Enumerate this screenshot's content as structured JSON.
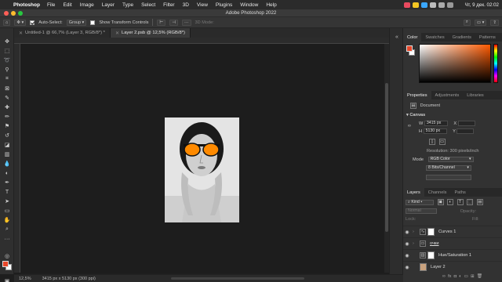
{
  "menubar": {
    "app_name": "Photoshop",
    "items": [
      "File",
      "Edit",
      "Image",
      "Layer",
      "Type",
      "Select",
      "Filter",
      "3D",
      "View",
      "Plugins",
      "Window",
      "Help"
    ],
    "clock": "Чт, 9 дек.  02:02"
  },
  "window": {
    "title": "Adobe Photoshop 2022"
  },
  "options_bar": {
    "auto_select_label": "Auto-Select:",
    "auto_select_value": "Group",
    "show_transform_label": "Show Transform Controls",
    "mode_3d_label": "3D Mode:"
  },
  "document_tabs": [
    {
      "label": "Untitled-1 @ 66,7% (Layer 3, RGB/8*) *",
      "active": false
    },
    {
      "label": "Layer 2.psb @ 12,5% (RGB/8*)",
      "active": true
    }
  ],
  "status_bar": {
    "zoom": "12,5%",
    "dimensions": "3415 px x 5130 px (300 ppi)"
  },
  "color_panel": {
    "tabs": [
      "Color",
      "Swatches",
      "Gradients",
      "Patterns"
    ],
    "foreground": "#e8472a",
    "background": "#ffffff"
  },
  "properties_panel": {
    "tabs": [
      "Properties",
      "Adjustments",
      "Libraries"
    ],
    "document_label": "Document",
    "canvas_label": "Canvas",
    "width_label": "W",
    "width_value": "3415 px",
    "height_label": "H",
    "height_value": "5130 px",
    "x_label": "X",
    "y_label": "Y",
    "resolution": "Resolution: 300 pixels/inch",
    "mode_label": "Mode",
    "mode_value": "RGB Color",
    "bits_value": "8 Bits/Channel"
  },
  "layers_panel": {
    "tabs": [
      "Layers",
      "Channels",
      "Paths"
    ],
    "filter_kind": "Kind",
    "blend_mode": "Normal",
    "opacity_label": "Opacity:",
    "lock_label": "Lock:",
    "fill_label": "Fill:",
    "layers": [
      {
        "name": "Curves 1",
        "type": "adjustment"
      },
      {
        "name": "очки",
        "type": "group"
      },
      {
        "name": "Hue/Saturation 1",
        "type": "adjustment"
      },
      {
        "name": "Layer 2",
        "type": "pixel"
      }
    ]
  },
  "icons": [
    "move-tool-icon",
    "marquee-tool-icon",
    "lasso-tool-icon",
    "brush-tool-icon",
    "type-tool-icon",
    "eye-icon",
    "search-icon",
    "cloud-icon"
  ],
  "colors": {
    "accent_orange": "#ff8a00",
    "panel_bg": "#323232",
    "canvas_bg": "#1d1d1d"
  }
}
